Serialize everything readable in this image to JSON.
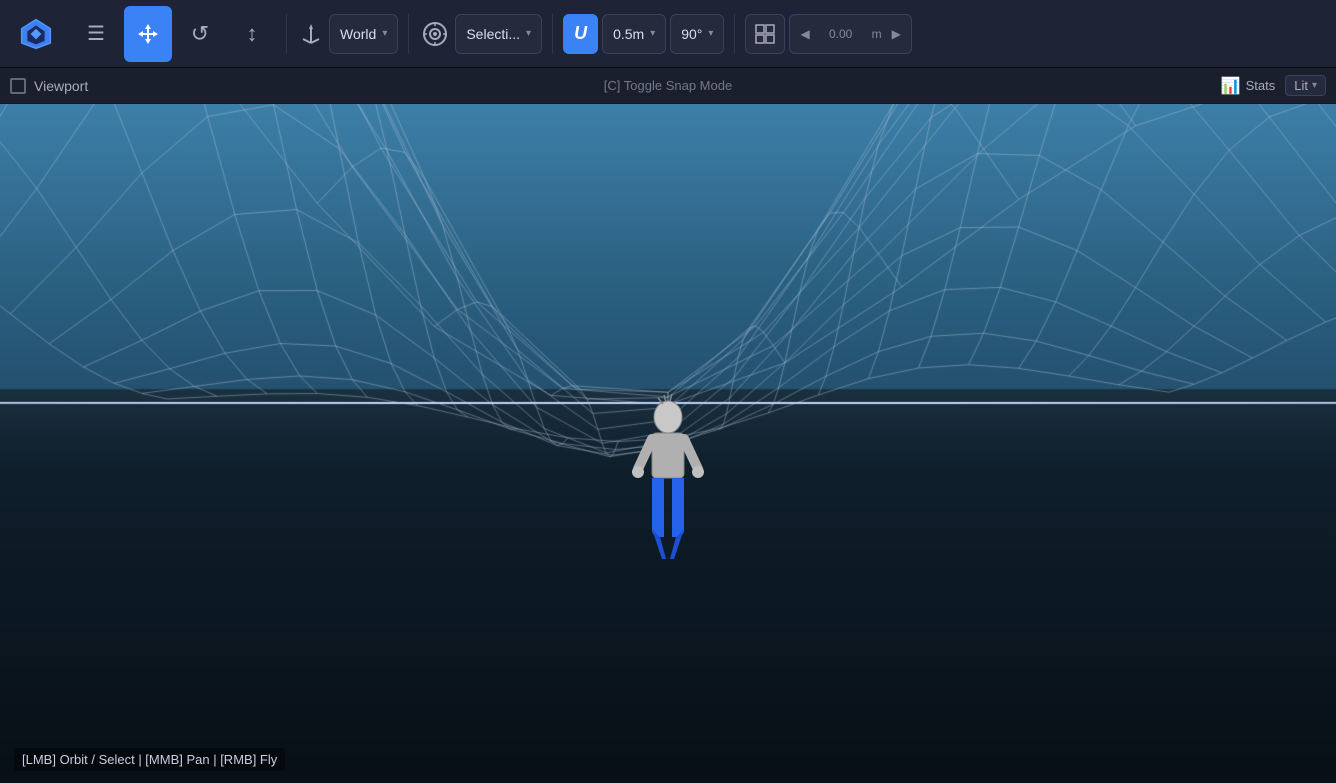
{
  "toolbar": {
    "logo_label": "App Logo",
    "menu_label": "☰",
    "move_label": "✛",
    "refresh_label": "↺",
    "axis_label": "↑",
    "transform_mode_label": "World",
    "transform_mode_caret": "▾",
    "target_icon": "⊙",
    "selection_label": "Selecti...",
    "selection_caret": "▾",
    "snap_icon": "U",
    "snap_size_label": "0.5m",
    "snap_size_caret": "▾",
    "snap_angle_label": "90°",
    "snap_angle_caret": "▾",
    "grid_icon": "⊞",
    "nav_left": "◀",
    "nav_value": "0.00",
    "nav_unit": "m",
    "nav_right": "▶"
  },
  "viewport": {
    "title": "Viewport",
    "toggle_snap_hint": "[C] Toggle Snap Mode",
    "stats_label": "Stats",
    "lit_label": "Lit",
    "lit_caret": "▾"
  },
  "bottom_hint": "[LMB] Orbit / Select | [MMB] Pan | [RMB] Fly",
  "colors": {
    "active_btn": "#3b82f6",
    "toolbar_bg": "#1e2336",
    "grid_color": "#ffffff",
    "sky_top": "#3d7fa8",
    "sky_bottom": "#1e4560",
    "ground_dark": "#0d1a22"
  }
}
